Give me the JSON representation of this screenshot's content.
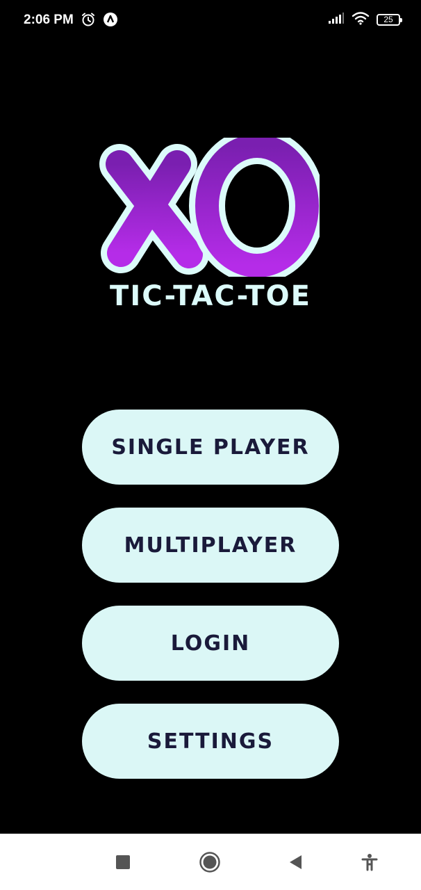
{
  "status_bar": {
    "time": "2:06 PM",
    "battery_level": "25",
    "left_icons": [
      "alarm-icon",
      "app-notification-icon"
    ],
    "right_icons": [
      "signal-icon",
      "wifi-icon",
      "battery-icon"
    ]
  },
  "logo": {
    "title": "XO",
    "subtitle": "TIC-TAC-TOE",
    "colors": {
      "fill": "#9b2bd6",
      "outline": "#dcfbfa"
    }
  },
  "menu": {
    "items": [
      {
        "label": "SINGLE PLAYER"
      },
      {
        "label": "MULTIPLAYER"
      },
      {
        "label": "LOGIN"
      },
      {
        "label": "SETTINGS"
      }
    ],
    "colors": {
      "button_bg": "#dbf7f6",
      "button_text": "#1a1a3a"
    }
  },
  "nav_bar": {
    "icons": [
      "recents-square-icon",
      "home-circle-icon",
      "back-triangle-icon",
      "accessibility-icon"
    ]
  },
  "colors": {
    "background": "#000000"
  }
}
